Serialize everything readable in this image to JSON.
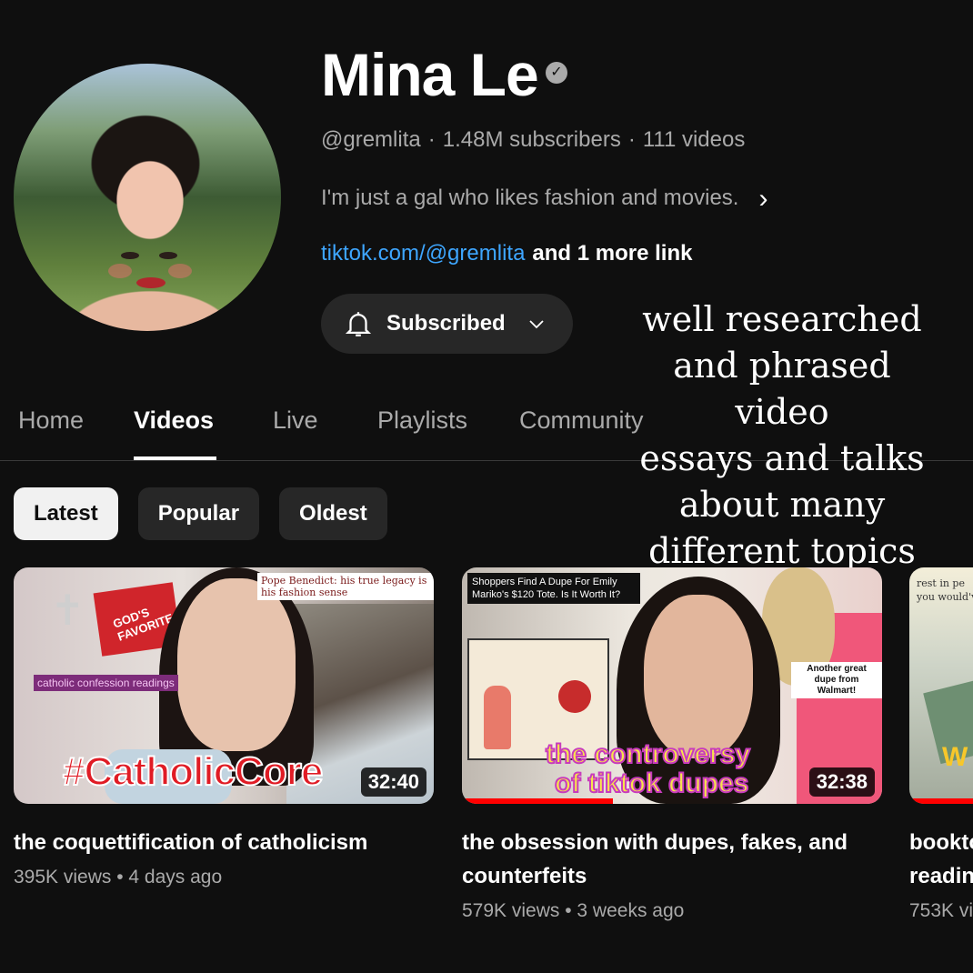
{
  "channel": {
    "name": "Mina Le",
    "handle": "@gremlita",
    "subscribers": "1.48M subscribers",
    "videos_count": "111 videos",
    "description": "I'm just a gal who likes fashion and movies.",
    "link": "tiktok.com/@gremlita",
    "more_links": "and 1 more link",
    "subscribe_label": "Subscribed"
  },
  "tabs": [
    "Home",
    "Videos",
    "Live",
    "Playlists",
    "Community"
  ],
  "active_tab": "Videos",
  "chips": [
    "Latest",
    "Popular",
    "Oldest"
  ],
  "active_chip": "Latest",
  "overlay_caption": [
    "well researched",
    "and phrased video",
    "essays and talks",
    "about many",
    "different topics"
  ],
  "videos": [
    {
      "title": "the coquettification of catholicism",
      "views": "395K views",
      "age": "4 days ago",
      "duration": "32:40",
      "thumb_text": {
        "banner": "Pope Benedict: his true legacy is his fashion sense",
        "hashtag": "#CatholicCore",
        "shirt": "GOD'S FAVORITE",
        "label": "catholic confession readings"
      }
    },
    {
      "title": "the obsession with dupes, fakes, and counterfeits",
      "views": "579K views",
      "age": "3 weeks ago",
      "duration": "32:38",
      "watched_fraction": 0.36,
      "thumb_text": {
        "banner": "Shoppers Find A Dupe For Emily Mariko's $120 Tote. Is It Worth It?",
        "big_line1": "the controversy",
        "big_line2": "of tiktok dupes",
        "sticker": "Another great dupe from Walmart!"
      }
    },
    {
      "title": "bookto",
      "title_line2": "readin",
      "views": "753K vi",
      "thumb_text": {
        "top": "rest in pe you would'v",
        "big": "W"
      }
    }
  ],
  "colors": {
    "background": "#0f0f0f",
    "link": "#3ea6ff",
    "chip_active": "#f1f1f1",
    "chip": "#272727",
    "progress": "#ff0000"
  }
}
